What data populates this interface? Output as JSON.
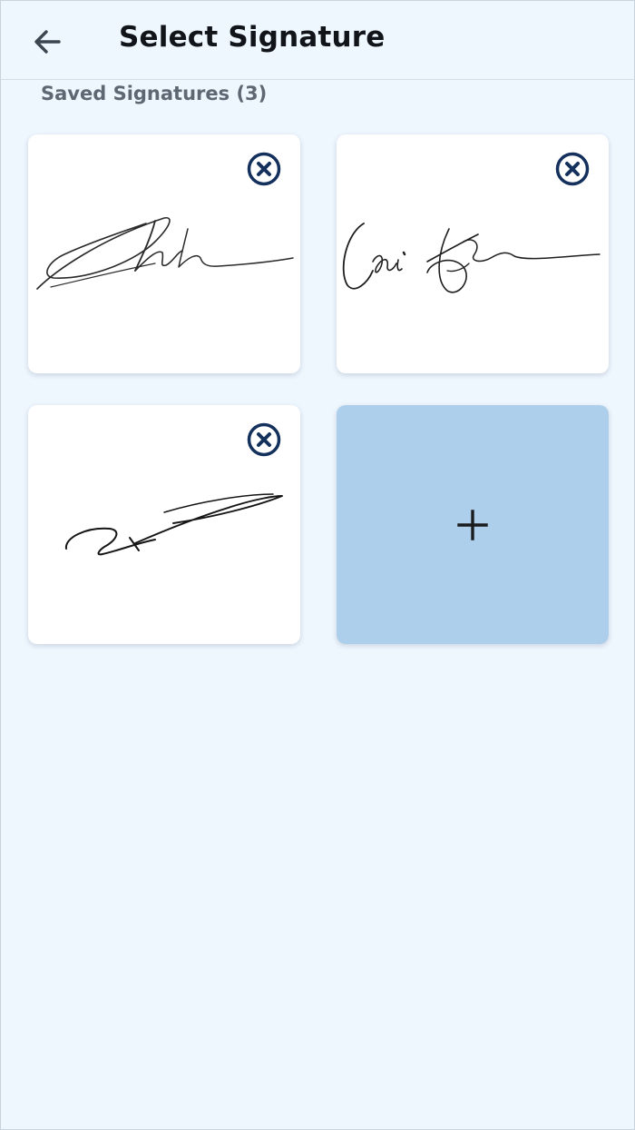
{
  "header": {
    "title": "Select Signature",
    "back_icon": "arrow-left-icon"
  },
  "saved": {
    "label": "Saved Signatures (3)"
  },
  "signatures": [
    {
      "remove_icon": "close-circle-icon"
    },
    {
      "remove_icon": "close-circle-icon"
    },
    {
      "remove_icon": "close-circle-icon"
    }
  ],
  "add": {
    "icon": "plus-icon"
  },
  "colors": {
    "background": "#eef6fe",
    "card": "#ffffff",
    "add_card": "#aecfeb",
    "remove_icon": "#14305c",
    "title": "#111418",
    "section_label": "#5d6873"
  }
}
